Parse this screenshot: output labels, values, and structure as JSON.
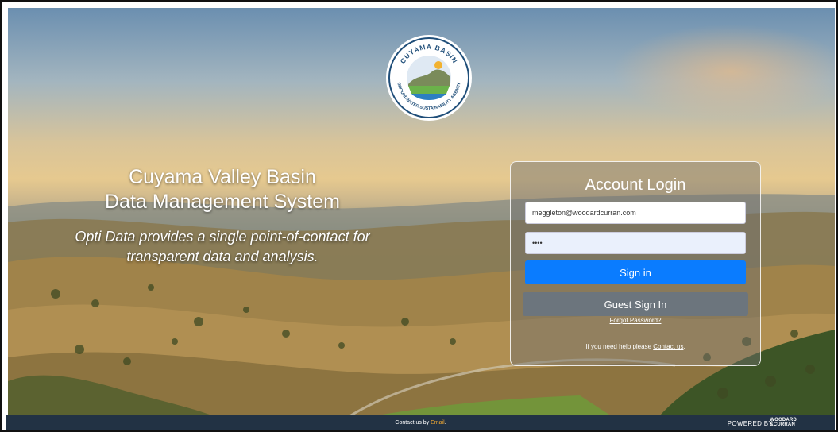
{
  "logo": {
    "arc_top": "CUYAMA BASIN",
    "arc_bottom": "GROUNDWATER SUSTAINABILITY AGENCY"
  },
  "hero": {
    "title_line1": "Cuyama Valley Basin",
    "title_line2": "Data Management System",
    "tagline_line1": "Opti Data provides a single point-of-contact for",
    "tagline_line2": "transparent data and analysis."
  },
  "login": {
    "title": "Account Login",
    "email_value": "meggleton@woodardcurran.com",
    "password_value": "••••",
    "sign_in_label": "Sign in",
    "guest_label": "Guest Sign In",
    "forgot_label": "Forgot Password?",
    "help_prefix": "If you need help please ",
    "help_link": "Contact us",
    "help_suffix": ".",
    "accent_color": "#0a7cff",
    "guest_color": "#6c757d"
  },
  "footer": {
    "contact_prefix": "Contact us by ",
    "contact_link": "Email",
    "contact_suffix": ".",
    "powered_by": "POWERED BY",
    "brand_line1": "WOODARD",
    "brand_line2": "&CURRAN"
  }
}
